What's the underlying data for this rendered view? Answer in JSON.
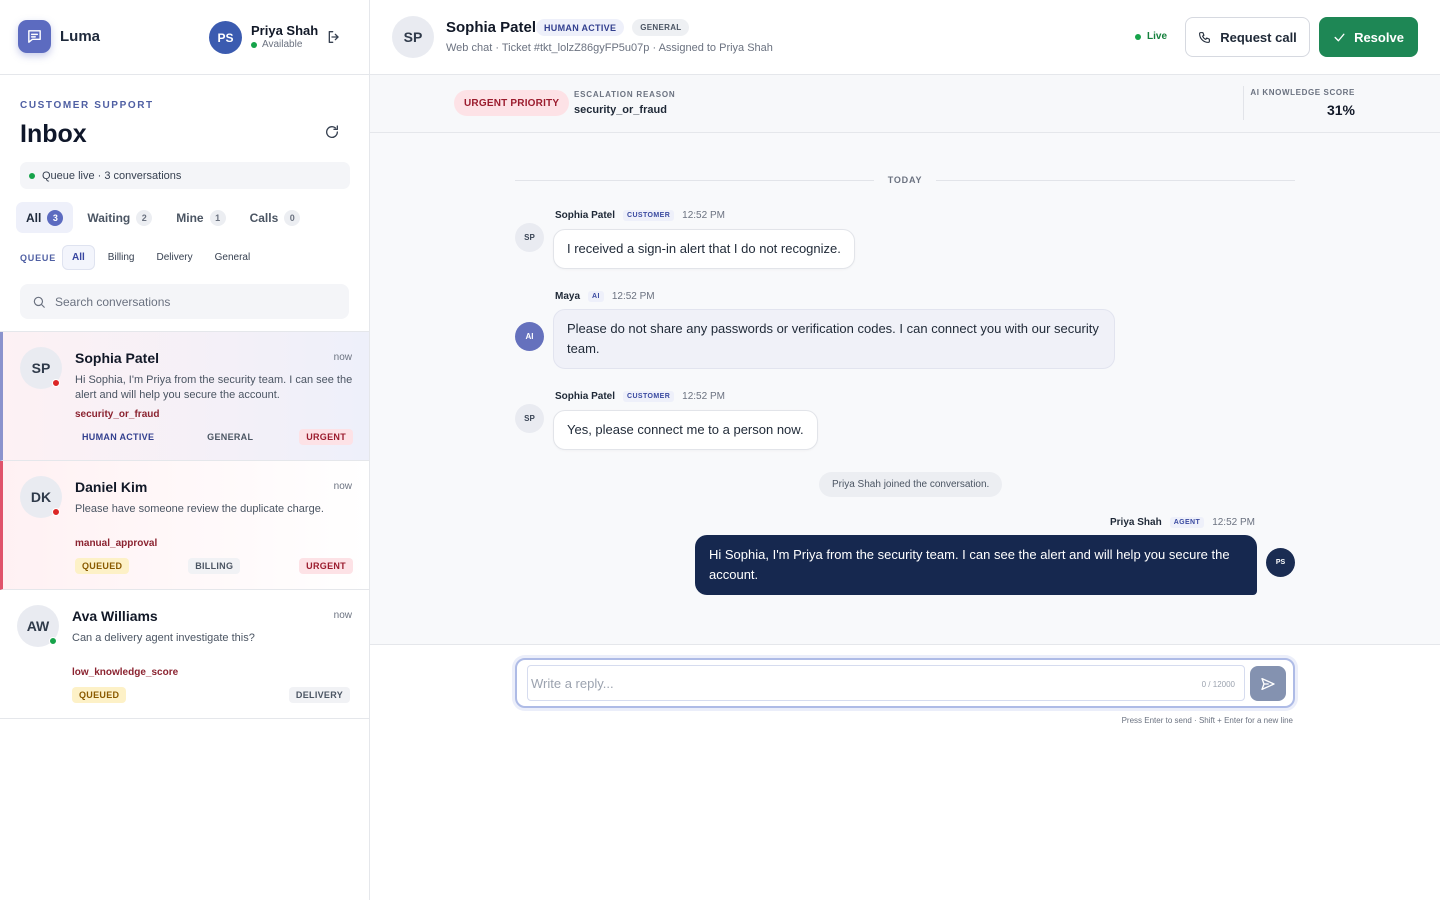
{
  "app": {
    "name": "Luma"
  },
  "me": {
    "initials": "PS",
    "name": "Priya Shah",
    "status": "Available"
  },
  "sidebar": {
    "kicker": "CUSTOMER SUPPORT",
    "title": "Inbox",
    "queue_status": "Queue live · 3 conversations",
    "tabs": [
      {
        "label": "All",
        "count": "3"
      },
      {
        "label": "Waiting",
        "count": "2"
      },
      {
        "label": "Mine",
        "count": "1"
      },
      {
        "label": "Calls",
        "count": "0"
      }
    ],
    "queue_label": "QUEUE",
    "queue_filters": [
      "All",
      "Billing",
      "Delivery",
      "General"
    ],
    "search_placeholder": "Search conversations",
    "conversations": [
      {
        "initials": "SP",
        "name": "Sophia Patel",
        "time": "now",
        "preview": "Hi Sophia, I'm Priya from the security team. I can see the alert and will help you secure the account.",
        "reason": "security_or_fraud",
        "tags": [
          "HUMAN ACTIVE",
          "GENERAL",
          "URGENT"
        ],
        "presence": "red"
      },
      {
        "initials": "DK",
        "name": "Daniel Kim",
        "time": "now",
        "preview": "Please have someone review the duplicate charge.",
        "reason": "manual_approval",
        "tags": [
          "QUEUED",
          "BILLING",
          "URGENT"
        ],
        "presence": "red"
      },
      {
        "initials": "AW",
        "name": "Ava Williams",
        "time": "now",
        "preview": "Can a delivery agent investigate this?",
        "reason": "low_knowledge_score",
        "tags": [
          "QUEUED",
          "DELIVERY"
        ],
        "presence": "green"
      }
    ]
  },
  "header": {
    "initials": "SP",
    "name": "Sophia Patel",
    "badges": [
      "HUMAN ACTIVE",
      "GENERAL"
    ],
    "subtitle": "Web chat · Ticket #tkt_lolzZ86gyFP5u07p · Assigned to Priya Shah",
    "live": "Live",
    "request_call": "Request call",
    "resolve": "Resolve"
  },
  "escalation": {
    "priority": "URGENT PRIORITY",
    "reason_label": "ESCALATION REASON",
    "reason_value": "security_or_fraud",
    "score_label": "AI KNOWLEDGE SCORE",
    "score_value": "31%"
  },
  "chat": {
    "day": "TODAY",
    "messages": [
      {
        "initials": "SP",
        "author": "Sophia Patel",
        "role": "CUSTOMER",
        "time": "12:52 PM",
        "text": "I received a sign-in alert that I do not recognize."
      },
      {
        "initials": "AI",
        "author": "Maya",
        "role": "AI",
        "time": "12:52 PM",
        "text": "Please do not share any passwords or verification codes. I can connect you with our security team."
      },
      {
        "initials": "SP",
        "author": "Sophia Patel",
        "role": "CUSTOMER",
        "time": "12:52 PM",
        "text": "Yes, please connect me to a person now."
      },
      {
        "initials": "PS",
        "author": "Priya Shah",
        "role": "AGENT",
        "time": "12:52 PM",
        "text": "Hi Sophia, I'm Priya from the security team. I can see the alert and will help you secure the account."
      }
    ],
    "system_note": "Priya Shah joined the conversation."
  },
  "composer": {
    "placeholder": "Write a reply...",
    "char_count": "0 / 12000",
    "hint": "Press Enter to send · Shift + Enter for a new line"
  },
  "colors": {
    "brand": "#5c6bc0",
    "resolve": "#1e8755",
    "agent_bubble": "#16284f",
    "urgent": "#9b1c2e"
  },
  "icons": [
    "chat-icon",
    "logout-icon",
    "refresh-icon",
    "search-icon",
    "phone-icon",
    "check-icon",
    "send-icon"
  ]
}
